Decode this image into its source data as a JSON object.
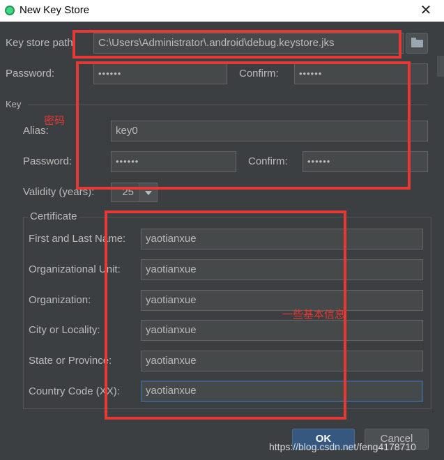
{
  "window": {
    "title": "New Key Store",
    "close_glyph": "✕"
  },
  "keystore": {
    "path_label": "Key store path:",
    "path_value": "C:\\Users\\Administrator\\.android\\debug.keystore.jks",
    "password_label": "Password:",
    "password_value": "••••••",
    "confirm_label": "Confirm:",
    "confirm_value": "••••••"
  },
  "key": {
    "section_label": "Key",
    "alias_label": "Alias:",
    "alias_value": "key0",
    "password_label": "Password:",
    "password_value": "••••••",
    "confirm_label": "Confirm:",
    "confirm_value": "••••••",
    "validity_label": "Validity (years):",
    "validity_value": "25"
  },
  "certificate": {
    "title": "Certificate",
    "fields": [
      {
        "label": "First and Last Name:",
        "value": "yaotianxue"
      },
      {
        "label": "Organizational Unit:",
        "value": "yaotianxue"
      },
      {
        "label": "Organization:",
        "value": "yaotianxue"
      },
      {
        "label": "City or Locality:",
        "value": "yaotianxue"
      },
      {
        "label": "State or Province:",
        "value": "yaotianxue"
      },
      {
        "label": "Country Code (XX):",
        "value": "yaotianxue"
      }
    ]
  },
  "buttons": {
    "ok": "OK",
    "cancel": "Cancel"
  },
  "annotations": {
    "password_note": "密码",
    "basic_info_note": "一些基本信息",
    "box_color": "#e53935"
  },
  "watermark": "https://blog.csdn.net/feng4178710",
  "icons": {
    "folder": "folder-icon",
    "app": "android-studio-icon",
    "spinner": "chevron-down-icon"
  }
}
